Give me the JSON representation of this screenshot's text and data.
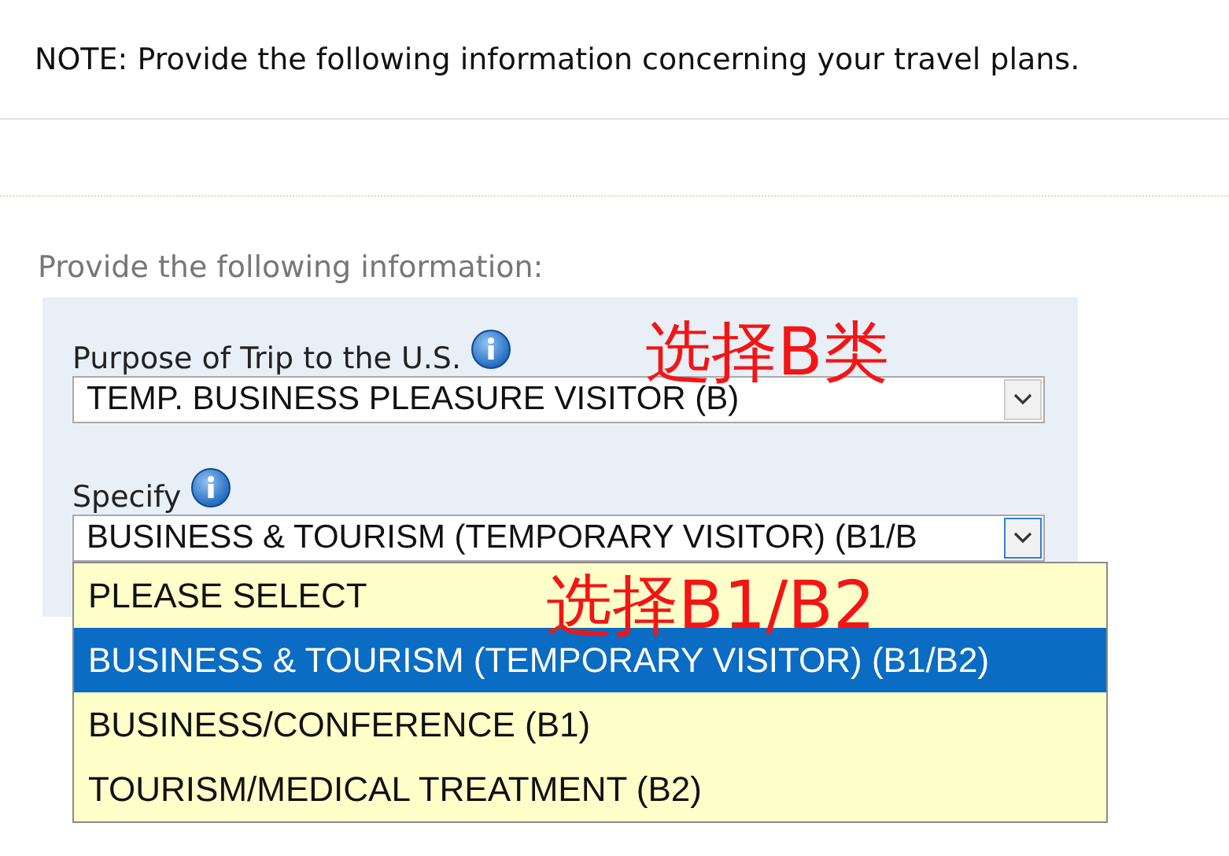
{
  "note": "NOTE: Provide the following information concerning your travel plans.",
  "section_heading": "Provide the following information:",
  "fields": [
    {
      "label": "Purpose of Trip to the U.S.",
      "value": "TEMP. BUSINESS PLEASURE VISITOR (B)",
      "focused": false
    },
    {
      "label": "Specify",
      "value": "BUSINESS & TOURISM (TEMPORARY VISITOR) (B1/B",
      "focused": true
    }
  ],
  "dropdown": {
    "options": [
      {
        "label": "PLEASE SELECT",
        "selected": false
      },
      {
        "label": "BUSINESS & TOURISM (TEMPORARY VISITOR) (B1/B2)",
        "selected": true
      },
      {
        "label": "BUSINESS/CONFERENCE (B1)",
        "selected": false
      },
      {
        "label": "TOURISM/MEDICAL TREATMENT (B2)",
        "selected": false
      }
    ]
  },
  "annotations": [
    "选择B类",
    "选择B1/B2"
  ]
}
